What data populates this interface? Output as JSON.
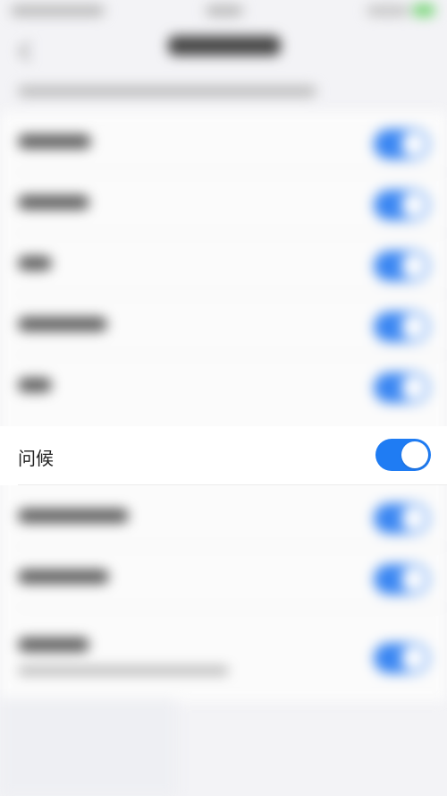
{
  "highlighted_setting": {
    "label": "问候",
    "toggle_state": "on",
    "toggle_color": "#1f7cf3"
  },
  "background": {
    "blurred_rows": 8,
    "toggle_color": "#3a86f2"
  }
}
